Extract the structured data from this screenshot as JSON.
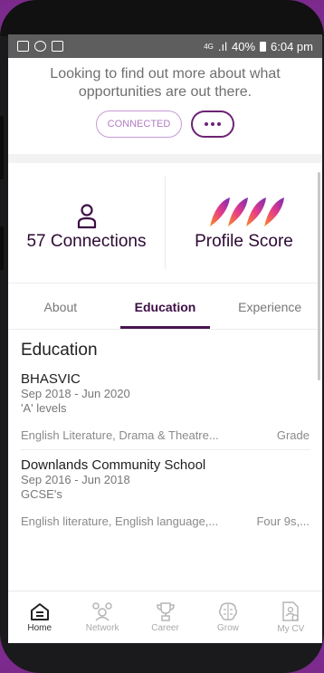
{
  "statusbar": {
    "network": "4G",
    "battery": "40%",
    "time": "6:04 pm"
  },
  "intro": {
    "text": "Looking to find out more about what opportunities are out there.",
    "connected_label": "CONNECTED"
  },
  "stats": {
    "connections": "57 Connections",
    "profile_score": "Profile Score"
  },
  "tabs": [
    {
      "label": "About"
    },
    {
      "label": "Education"
    },
    {
      "label": "Experience"
    }
  ],
  "education": {
    "heading": "Education",
    "entries": [
      {
        "school": "BHASVIC",
        "dates": "Sep 2018 - Jun 2020",
        "qualification": "'A' levels",
        "subjects": "English Literature, Drama & Theatre...",
        "grade": "Grade"
      },
      {
        "school": "Downlands Community School",
        "dates": "Sep 2016 - Jun 2018",
        "qualification": "GCSE's",
        "subjects": "English literature, English language,...",
        "grade": "Four 9s,..."
      }
    ]
  },
  "nav": [
    {
      "label": "Home",
      "icon": "home-icon"
    },
    {
      "label": "Network",
      "icon": "network-icon"
    },
    {
      "label": "Career",
      "icon": "trophy-icon"
    },
    {
      "label": "Grow",
      "icon": "brain-icon"
    },
    {
      "label": "My CV",
      "icon": "cv-icon"
    }
  ],
  "colors": {
    "brand": "#6d2274",
    "accent_light": "#c79ad6"
  }
}
